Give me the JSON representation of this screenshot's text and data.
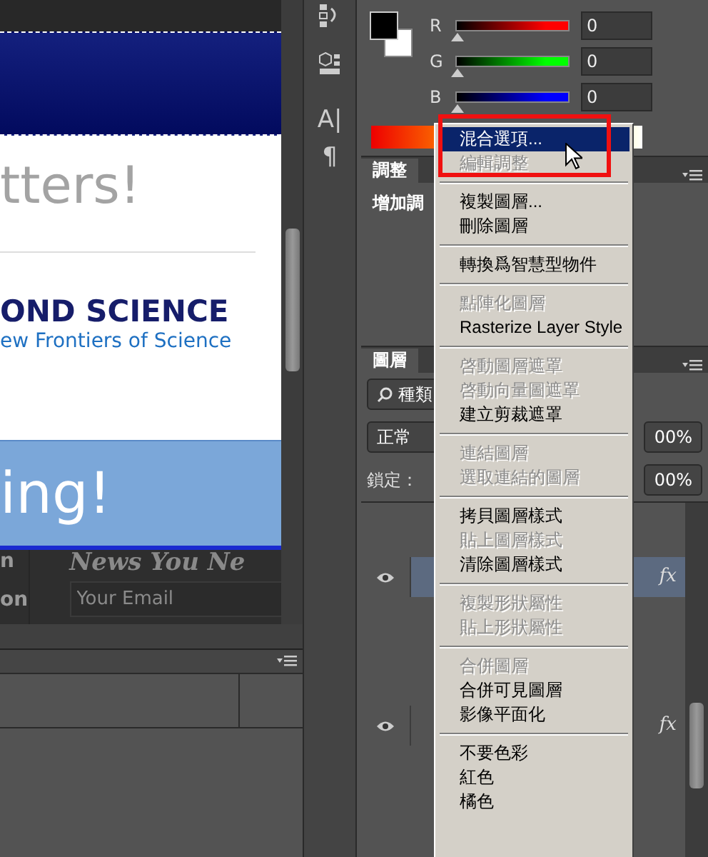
{
  "document": {
    "headline": "tters!",
    "brand": "OND SCIENCE",
    "tagline": "ew Frontiers of Science",
    "banner": "ing!",
    "footer_fragments": [
      "n",
      "on"
    ],
    "newsletter_heading": "News You Ne",
    "email_field": {
      "placeholder": "Your Email"
    }
  },
  "tools": [
    {
      "kind": "history"
    },
    {
      "kind": "cube"
    },
    {
      "kind": "glyph",
      "glyph": "A|"
    },
    {
      "kind": "glyph",
      "glyph": "¶"
    }
  ],
  "color_panel": {
    "channels": [
      {
        "label": "R",
        "level": 0,
        "value": "0",
        "color": "#ff0000"
      },
      {
        "label": "G",
        "level": 0,
        "value": "0",
        "color": "#00ff00"
      },
      {
        "label": "B",
        "level": 0,
        "value": "0",
        "color": "#0000ff"
      }
    ]
  },
  "adjustments_panel": {
    "tabs": [
      {
        "label": "調整",
        "selected": true
      }
    ],
    "heading": "增加調"
  },
  "layers_panel": {
    "tabs": [
      {
        "label": "圖層",
        "selected": true
      }
    ],
    "filter": "種類",
    "blend_mode": "正常",
    "opacity": "00%",
    "lock_label": "鎖定：",
    "fill": "00%",
    "layers": [
      {
        "visible": true,
        "selected": true,
        "effects": "fx"
      },
      {
        "visible": true,
        "selected": false,
        "effects": "fx"
      }
    ]
  },
  "context_menu": {
    "groups": [
      [
        {
          "label": "混合選項...",
          "selected": true,
          "disabled": false
        },
        {
          "label": "編輯調整",
          "selected": false,
          "disabled": true
        }
      ],
      [
        {
          "label": "複製圖層...",
          "selected": false,
          "disabled": false
        },
        {
          "label": "刪除圖層",
          "selected": false,
          "disabled": false
        }
      ],
      [
        {
          "label": "轉換爲智慧型物件",
          "selected": false,
          "disabled": false
        }
      ],
      [
        {
          "label": "點陣化圖層",
          "selected": false,
          "disabled": true
        },
        {
          "label": "Rasterize Layer Style",
          "selected": false,
          "disabled": false
        }
      ],
      [
        {
          "label": "啓動圖層遮罩",
          "selected": false,
          "disabled": true
        },
        {
          "label": "啓動向量圖遮罩",
          "selected": false,
          "disabled": true
        },
        {
          "label": "建立剪裁遮罩",
          "selected": false,
          "disabled": false
        }
      ],
      [
        {
          "label": "連結圖層",
          "selected": false,
          "disabled": true
        },
        {
          "label": "選取連結的圖層",
          "selected": false,
          "disabled": true
        }
      ],
      [
        {
          "label": "拷貝圖層樣式",
          "selected": false,
          "disabled": false
        },
        {
          "label": "貼上圖層樣式",
          "selected": false,
          "disabled": true
        },
        {
          "label": "清除圖層樣式",
          "selected": false,
          "disabled": false
        }
      ],
      [
        {
          "label": "複製形狀屬性",
          "selected": false,
          "disabled": true
        },
        {
          "label": "貼上形狀屬性",
          "selected": false,
          "disabled": true
        }
      ],
      [
        {
          "label": "合併圖層",
          "selected": false,
          "disabled": true
        },
        {
          "label": "合併可見圖層",
          "selected": false,
          "disabled": false
        },
        {
          "label": "影像平面化",
          "selected": false,
          "disabled": false
        }
      ],
      [
        {
          "label": "不要色彩",
          "selected": false,
          "disabled": false
        },
        {
          "label": "紅色",
          "selected": false,
          "disabled": false
        },
        {
          "label": "橘色",
          "selected": false,
          "disabled": false
        }
      ]
    ]
  }
}
